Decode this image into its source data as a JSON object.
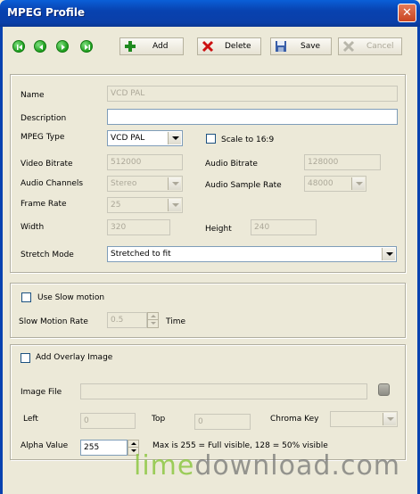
{
  "window": {
    "title": "MPEG Profile",
    "close_glyph": "✕"
  },
  "nav": {
    "icons": [
      "first-icon",
      "prev-icon",
      "next-icon",
      "last-icon"
    ]
  },
  "toolbar": {
    "add": "Add",
    "delete": "Delete",
    "save": "Save",
    "cancel": "Cancel"
  },
  "profile": {
    "name_label": "Name",
    "name_value": "VCD PAL",
    "description_label": "Description",
    "description_value": "",
    "mpeg_type_label": "MPEG Type",
    "mpeg_type_value": "VCD PAL",
    "scale_label": "Scale to 16:9",
    "video_bitrate_label": "Video Bitrate",
    "video_bitrate_value": "512000",
    "audio_bitrate_label": "Audio Bitrate",
    "audio_bitrate_value": "128000",
    "audio_channels_label": "Audio Channels",
    "audio_channels_value": "Stereo",
    "audio_sample_rate_label": "Audio Sample Rate",
    "audio_sample_rate_value": "48000",
    "frame_rate_label": "Frame Rate",
    "frame_rate_value": "25",
    "width_label": "Width",
    "width_value": "320",
    "height_label": "Height",
    "height_value": "240",
    "stretch_mode_label": "Stretch Mode",
    "stretch_mode_value": "Stretched to fit"
  },
  "slow_motion": {
    "use_label": "Use Slow motion",
    "rate_label": "Slow Motion Rate",
    "rate_value": "0.5",
    "rate_unit": "Time"
  },
  "overlay": {
    "add_label": "Add Overlay Image",
    "image_file_label": "Image File",
    "image_file_value": "",
    "left_label": "Left",
    "left_value": "0",
    "top_label": "Top",
    "top_value": "0",
    "chroma_key_label": "Chroma Key",
    "chroma_key_value": "",
    "alpha_label": "Alpha Value",
    "alpha_value": "255",
    "alpha_hint": "Max is 255 = Full visible, 128 = 50% visible"
  },
  "watermark": {
    "part1": "lime",
    "part2": "download.com"
  },
  "colors": {
    "titlebar": "#0842b0",
    "face": "#ece9d8",
    "nav_green": "#1b9c1b",
    "delete_red": "#cc1111",
    "add_green": "#1f8a1f"
  }
}
